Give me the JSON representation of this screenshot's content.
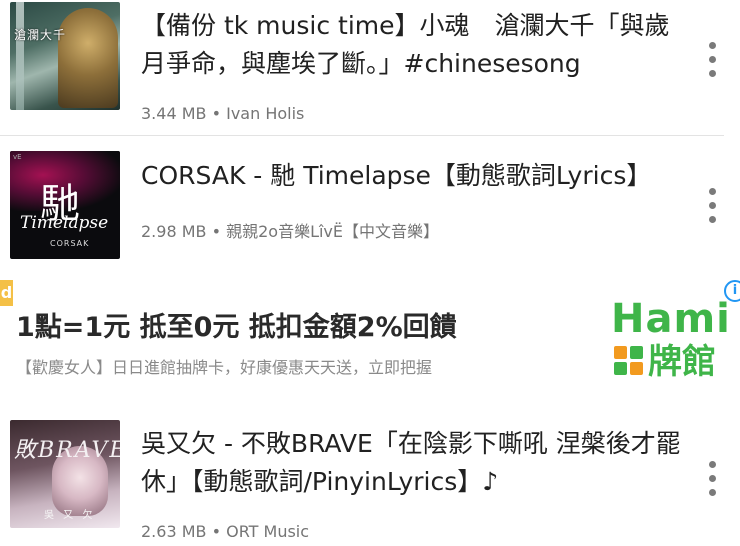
{
  "items": [
    {
      "title": "【備份 tk music time】小魂　滄瀾大千「與歲月爭命，與塵埃了斷。」#chinesesong",
      "meta": "3.44 MB • Ivan Holis",
      "thumb_caption": "滄瀾大千"
    },
    {
      "title": "CORSAK - 馳 Timelapse【動態歌詞Lyrics】",
      "meta": "2.98 MB • 親親2o音樂LîvЁ【中文音樂】",
      "thumb_big": "馳",
      "thumb_script": "Timelapse",
      "thumb_name": "CORSAK",
      "thumb_corner": "vE"
    },
    {
      "title": "吳又欠 - 不敗BRAVE「在陰影下嘶吼 涅槃後才罷休」【動態歌詞/PinyinLyrics】♪",
      "meta": "2.63 MB • ORT Music",
      "thumb_text": "敗BRAVE",
      "thumb_sub": "吳 又 欠"
    }
  ],
  "ad": {
    "badge": "d",
    "headline": "1點=1元 抵至0元 抵扣金額2%回饋",
    "description": "【歡慶女人】日日進館抽牌卡，好康優惠天天送，立即把握",
    "brand_word": "Hami",
    "brand_sub": "牌館",
    "info_glyph": "i",
    "brand_color": "#3fb549"
  }
}
